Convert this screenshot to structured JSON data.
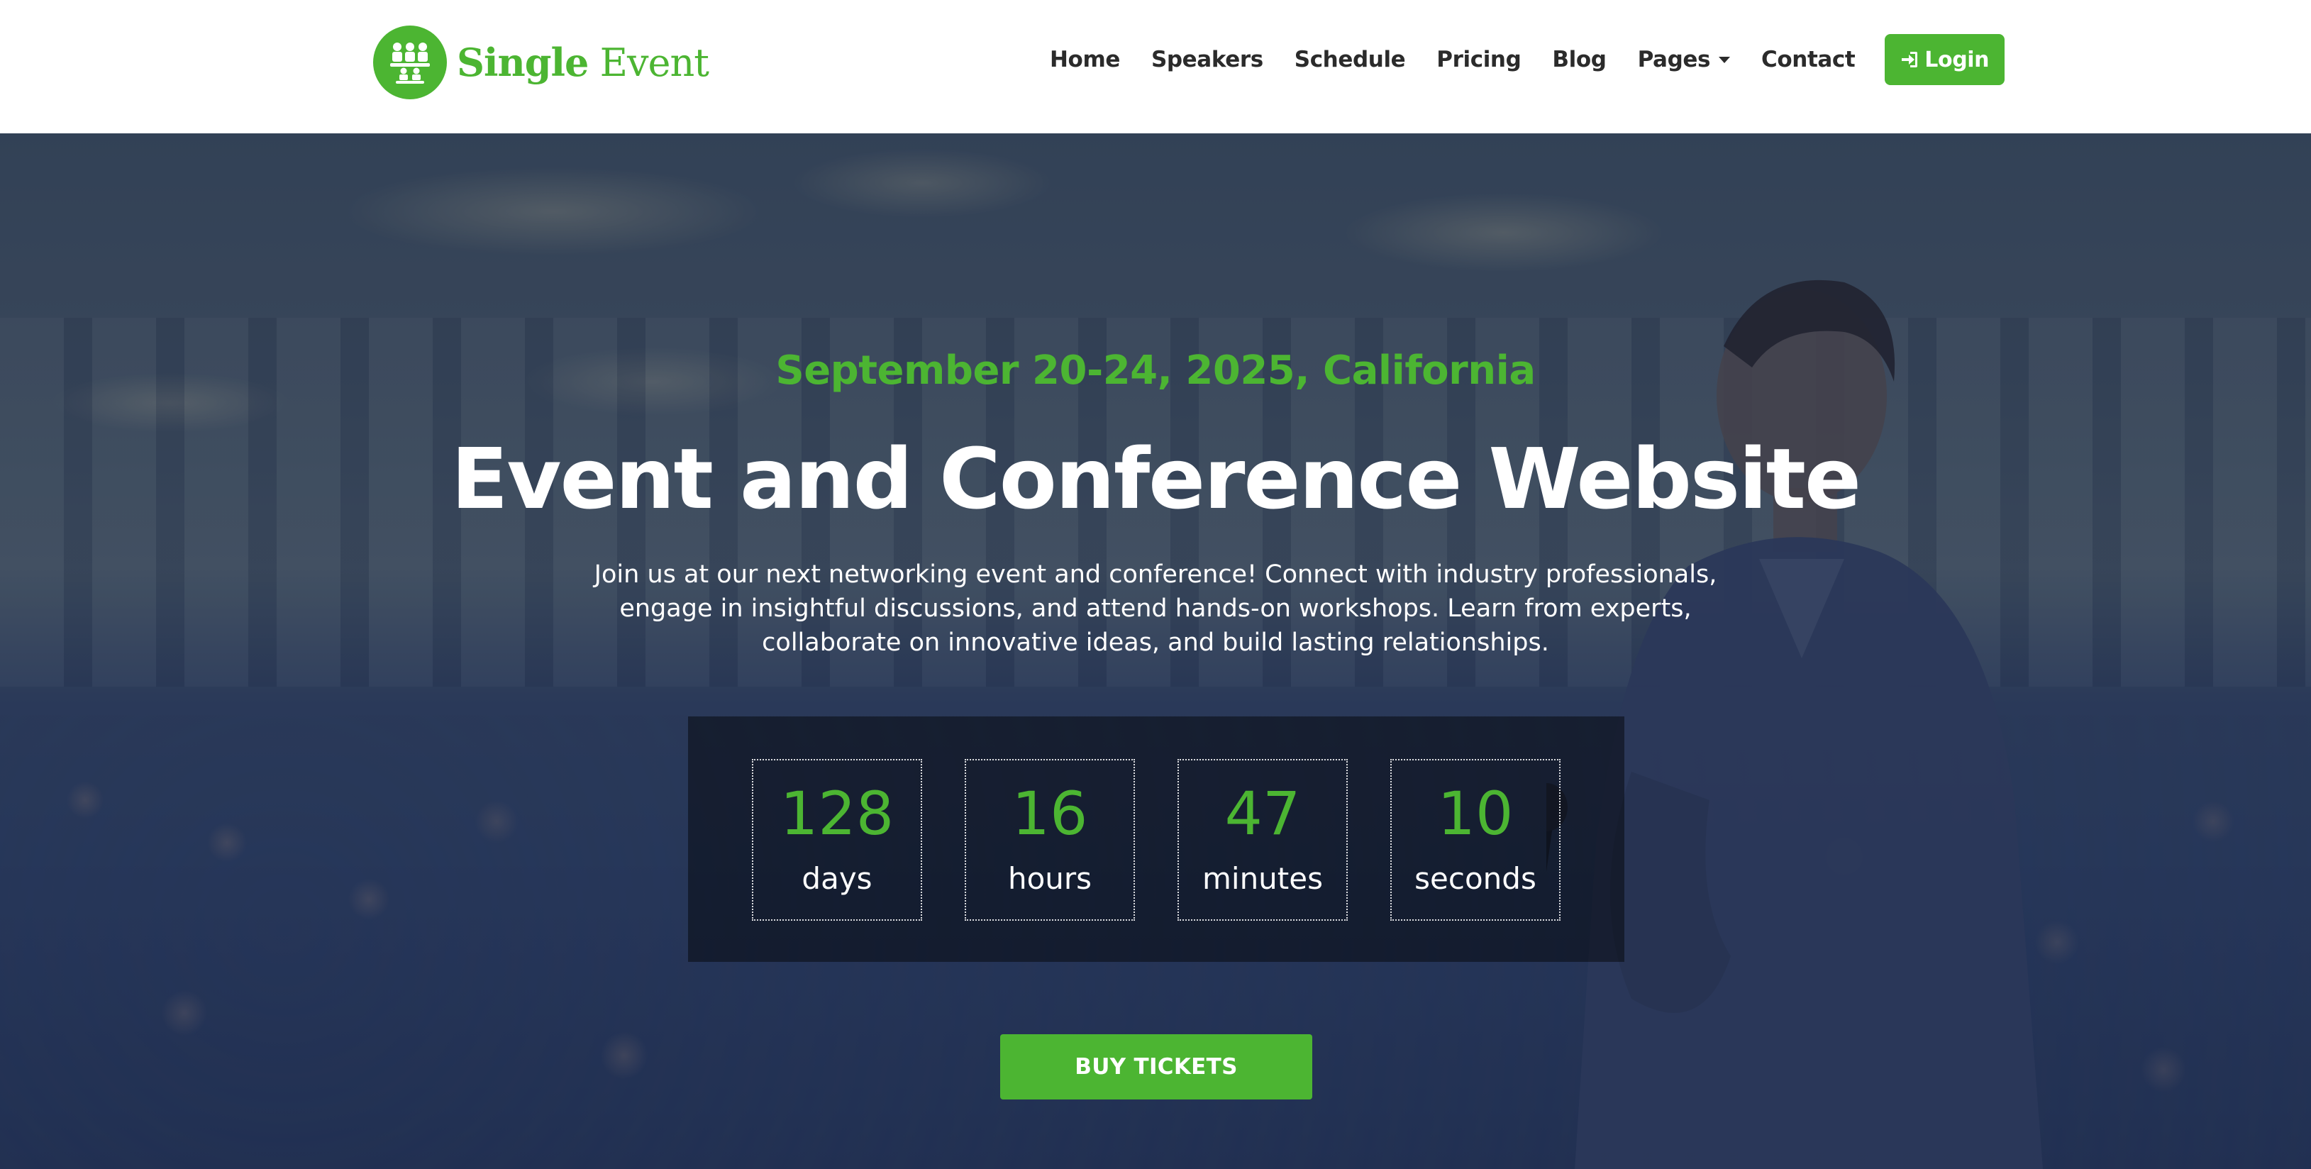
{
  "brand": {
    "name_bold": "Single",
    "name_light": "Event",
    "logo_icon": "audience-seats-icon"
  },
  "nav": {
    "items": [
      {
        "label": "Home"
      },
      {
        "label": "Speakers"
      },
      {
        "label": "Schedule"
      },
      {
        "label": "Pricing"
      },
      {
        "label": "Blog"
      },
      {
        "label": "Pages",
        "has_dropdown": true
      },
      {
        "label": "Contact"
      }
    ],
    "login_label": "Login",
    "login_icon": "sign-in-icon"
  },
  "hero": {
    "date_location": "September 20-24, 2025, California",
    "title": "Event and Conference Website",
    "description": "Join us at our next networking event and conference! Connect with industry professionals, engage in insightful discussions, and attend hands-on workshops. Learn from experts, collaborate on innovative ideas, and build lasting relationships.",
    "countdown": [
      {
        "value": "128",
        "label": "days"
      },
      {
        "value": "16",
        "label": "hours"
      },
      {
        "value": "47",
        "label": "minutes"
      },
      {
        "value": "10",
        "label": "seconds"
      }
    ],
    "cta_label": "BUY TICKETS"
  },
  "colors": {
    "accent": "#4cb532",
    "nav_text": "#2b2b2b",
    "hero_overlay": "#162448"
  }
}
